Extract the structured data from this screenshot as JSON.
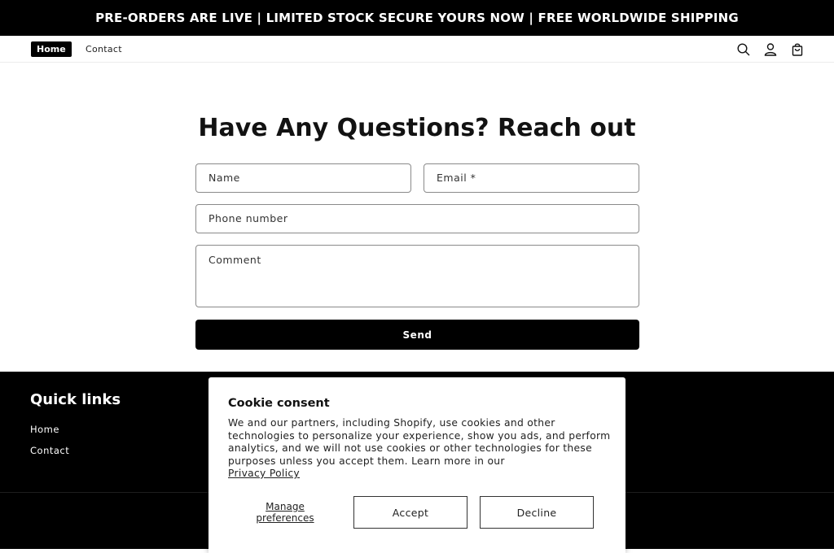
{
  "announcement": {
    "text": "PRE-ORDERS ARE LIVE | LIMITED STOCK SECURE YOURS NOW | FREE WORLDWIDE SHIPPING"
  },
  "header": {
    "nav": [
      {
        "label": "Home",
        "active": true
      },
      {
        "label": "Contact",
        "active": false
      }
    ],
    "icons": [
      "search-icon",
      "account-icon",
      "cart-icon"
    ]
  },
  "contact_form": {
    "title": "Have Any Questions? Reach out",
    "fields": {
      "name": {
        "placeholder": "Name",
        "value": ""
      },
      "email": {
        "placeholder": "Email *",
        "value": ""
      },
      "phone": {
        "placeholder": "Phone number",
        "value": ""
      },
      "comment": {
        "placeholder": "Comment",
        "value": ""
      }
    },
    "submit_label": "Send"
  },
  "footer": {
    "quick_links_title": "Quick links",
    "links": [
      "Home",
      "Contact"
    ]
  },
  "cookie_banner": {
    "title": "Cookie consent",
    "body": "We and our partners, including Shopify, use cookies and other technologies to personalize your experience, show you ads, and perform analytics, and we will not use cookies or other technologies for these purposes unless you accept them. Learn more in our",
    "privacy_link": "Privacy Policy",
    "manage_label": "Manage preferences",
    "accept_label": "Accept",
    "decline_label": "Decline"
  },
  "colors": {
    "primary": "#000000",
    "background": "#ffffff",
    "text": "#121212"
  }
}
